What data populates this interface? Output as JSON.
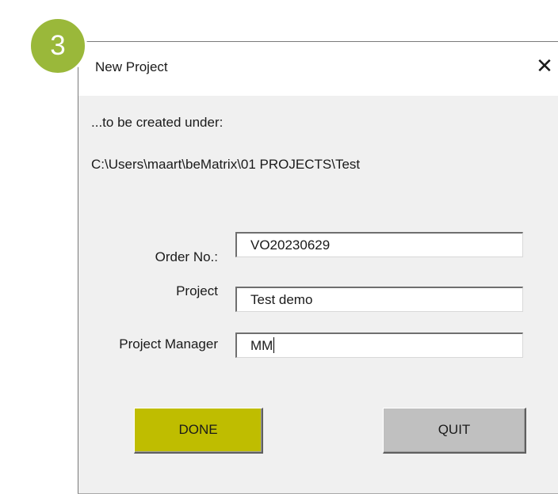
{
  "step_number": "3",
  "dialog": {
    "title": "New Project",
    "close_glyph": "✕",
    "created_under_text": "...to be created under:",
    "path": "C:\\Users\\maart\\beMatrix\\01 PROJECTS\\Test"
  },
  "form": {
    "order_label": "Order No.:",
    "order_value": "VO20230629",
    "project_label": "Project",
    "project_value": "Test demo",
    "manager_label": "Project Manager",
    "manager_value": "MM"
  },
  "buttons": {
    "done_label": "DONE",
    "quit_label": "QUIT"
  },
  "colors": {
    "badge": "#9ab83a",
    "done_button": "#bfbd00",
    "quit_button": "#c0c0c0",
    "dialog_background": "#f0f0f0"
  }
}
